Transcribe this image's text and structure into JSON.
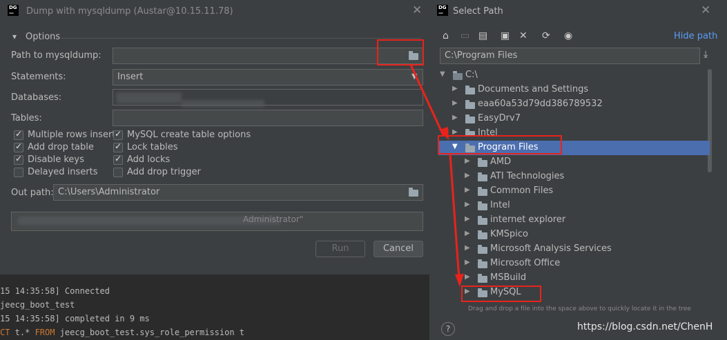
{
  "dump_dialog": {
    "title": "Dump with mysqldump (Austar@10.15.11.78)",
    "options_label": "Options",
    "path_label": "Path to mysqldump:",
    "path_value": "",
    "statements_label": "Statements:",
    "statements_value": "Insert",
    "databases_label": "Databases:",
    "tables_label": "Tables:",
    "checkboxes": [
      {
        "label": "Multiple rows inserts",
        "checked": true
      },
      {
        "label": "MySQL create table options",
        "checked": true
      },
      {
        "label": "Add drop table",
        "checked": true
      },
      {
        "label": "Lock tables",
        "checked": true
      },
      {
        "label": "Disable keys",
        "checked": true
      },
      {
        "label": "Add locks",
        "checked": true
      },
      {
        "label": "Delayed inserts",
        "checked": false
      },
      {
        "label": "Add drop trigger",
        "checked": false
      }
    ],
    "out_path_label": "Out path:",
    "out_path_value": "C:\\Users\\Administrator",
    "command_tail": "Administrator\"",
    "run_label": "Run",
    "cancel_label": "Cancel"
  },
  "console": {
    "lines": [
      {
        "prefix": "15 14:35:58] ",
        "text": "Connected"
      },
      {
        "prefix": "",
        "text": "jeecg_boot_test"
      },
      {
        "prefix": "15 14:35:58] ",
        "text": "completed in 9 ms"
      }
    ],
    "sql_kw1": "CT",
    "sql_mid": " t.* ",
    "sql_kw2": "FROM",
    "sql_tail": " jeecg_boot_test.sys_role_permission t"
  },
  "select_path": {
    "title": "Select Path",
    "hide_path_label": "Hide path",
    "path_value": "C:\\Program Files",
    "tree": [
      {
        "name": "C:\\",
        "level": 0,
        "expanded": true,
        "selected": false,
        "drive": true
      },
      {
        "name": "Documents and Settings",
        "level": 1,
        "expanded": false,
        "selected": false
      },
      {
        "name": "eaa60a53d79dd386789532",
        "level": 1,
        "expanded": false,
        "selected": false
      },
      {
        "name": "EasyDrv7",
        "level": 1,
        "expanded": false,
        "selected": false
      },
      {
        "name": "Intel",
        "level": 1,
        "expanded": false,
        "selected": false
      },
      {
        "name": "Program Files",
        "level": 1,
        "expanded": true,
        "selected": true
      },
      {
        "name": "AMD",
        "level": 2,
        "expanded": false,
        "selected": false
      },
      {
        "name": "ATI Technologies",
        "level": 2,
        "expanded": false,
        "selected": false
      },
      {
        "name": "Common Files",
        "level": 2,
        "expanded": false,
        "selected": false
      },
      {
        "name": "Intel",
        "level": 2,
        "expanded": false,
        "selected": false
      },
      {
        "name": "internet explorer",
        "level": 2,
        "expanded": false,
        "selected": false
      },
      {
        "name": "KMSpico",
        "level": 2,
        "expanded": false,
        "selected": false
      },
      {
        "name": "Microsoft Analysis Services",
        "level": 2,
        "expanded": false,
        "selected": false
      },
      {
        "name": "Microsoft Office",
        "level": 2,
        "expanded": false,
        "selected": false
      },
      {
        "name": "MSBuild",
        "level": 2,
        "expanded": false,
        "selected": false
      },
      {
        "name": "MySQL",
        "level": 2,
        "expanded": false,
        "selected": false
      }
    ],
    "hint": "Drag and drop a file into the space above to quickly locate it in the tree",
    "help_label": "?",
    "watermark": "https://blog.csdn.net/ChenH"
  },
  "colors": {
    "annotation_red": "#e8231c",
    "selection": "#4b6eaf",
    "link_blue": "#589df6"
  }
}
